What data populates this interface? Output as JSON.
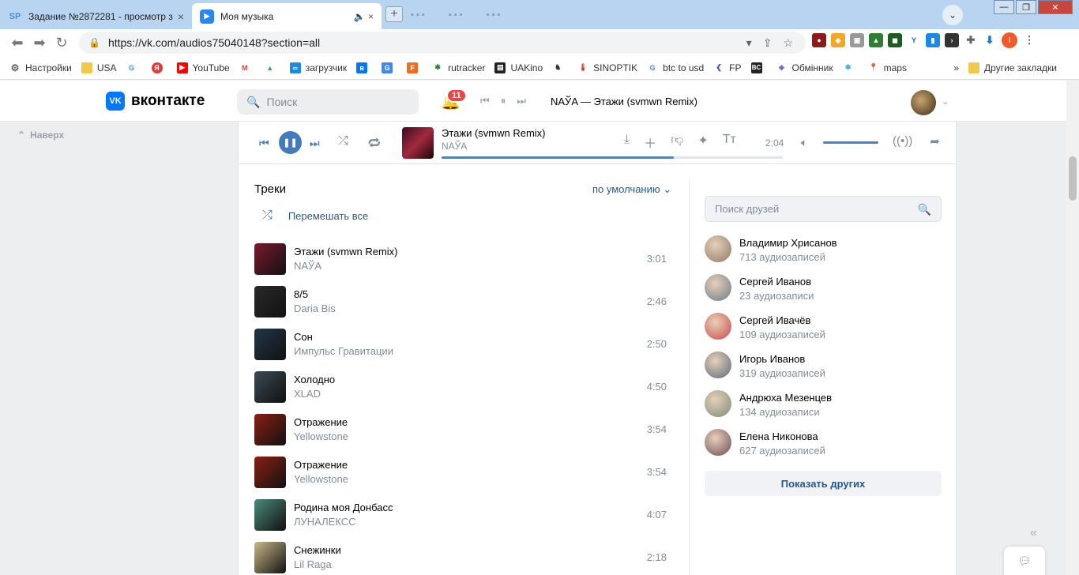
{
  "browser": {
    "tabs": [
      {
        "label": "Задание №2872281 - просмотр з",
        "icon": "SP"
      },
      {
        "label": "Моя музыка",
        "icon": "▶"
      }
    ],
    "url": "https://vk.com/audios75040148?section=all",
    "bookmarks": [
      {
        "label": "Настройки",
        "color": "#5f6368"
      },
      {
        "label": "USA",
        "color": "#f2c94c"
      },
      {
        "label": "",
        "color": "#4285f4"
      },
      {
        "label": "",
        "color": "#e53935"
      },
      {
        "label": "YouTube",
        "color": "#ff0000"
      },
      {
        "label": "",
        "color": "#d44638"
      },
      {
        "label": "",
        "color": "#34a853"
      },
      {
        "label": "загрузчик",
        "color": "#1e88e5"
      },
      {
        "label": "",
        "color": "#0077ff"
      },
      {
        "label": "",
        "color": "#4285f4"
      },
      {
        "label": "",
        "color": "#f26d21"
      },
      {
        "label": "rutracker",
        "color": "#2e7d32"
      },
      {
        "label": "UAKino",
        "color": "#222222"
      },
      {
        "label": "",
        "color": "#333333"
      },
      {
        "label": "SINOPTIK",
        "color": "#d32f2f"
      },
      {
        "label": "btc to usd",
        "color": "#4285f4"
      },
      {
        "label": "FP",
        "color": "#3f51b5"
      },
      {
        "label": "",
        "color": "#222222"
      },
      {
        "label": "Обмінник",
        "color": "#5c6bc0"
      },
      {
        "label": "",
        "color": "#29b6f6"
      },
      {
        "label": "maps",
        "color": "#34a853"
      }
    ],
    "other_bookmarks": "Другие закладки"
  },
  "header": {
    "logo_text": "вконтакте",
    "search_placeholder": "Поиск",
    "notifications_count": "11",
    "now_playing": "NAЎA — Этажи (svmwn Remix)"
  },
  "to_top": "Наверх",
  "player": {
    "title": "Этажи (svmwn Remix)",
    "artist": "NAЎA",
    "time": "2:04",
    "progress": 0.68
  },
  "tracks": {
    "title": "Треки",
    "sort_label": "по умолчанию",
    "shuffle_label": "Перемешать все",
    "items": [
      {
        "name": "Этажи (svmwn Remix)",
        "artist": "NAЎA",
        "duration": "3:01",
        "cover": "#7a1a2e"
      },
      {
        "name": "8/5",
        "artist": "Daria Bis",
        "duration": "2:46",
        "cover": "#2a2a2a"
      },
      {
        "name": "Сон",
        "artist": "Импульс Гравитации",
        "duration": "2:50",
        "cover": "#23364a"
      },
      {
        "name": "Холодно",
        "artist": "XLAD",
        "duration": "4:50",
        "cover": "#3a4a55"
      },
      {
        "name": "Отражение",
        "artist": "Yellowstone",
        "duration": "3:54",
        "cover": "#8a1f12"
      },
      {
        "name": "Отражение",
        "artist": "Yellowstone",
        "duration": "3:54",
        "cover": "#8a1f12"
      },
      {
        "name": "Родина моя Донбасс",
        "artist": "ЛУНАЛЕКСС",
        "duration": "4:07",
        "cover": "#4a8a7a"
      },
      {
        "name": "Снежинки",
        "artist": "Lil Raga",
        "duration": "2:18",
        "cover": "#c9b98a"
      }
    ]
  },
  "friends": {
    "search_placeholder": "Поиск друзей",
    "items": [
      {
        "name": "Владимир Хрисанов",
        "count": "713 аудиозаписей",
        "color": "#8a7a6a"
      },
      {
        "name": "Сергей Иванов",
        "count": "23 аудиозаписи",
        "color": "#6a7a8a"
      },
      {
        "name": "Сергей Ивачёв",
        "count": "109 аудиозаписей",
        "color": "#c94a4a"
      },
      {
        "name": "Игорь Иванов",
        "count": "319 аудиозаписей",
        "color": "#5a6a7a"
      },
      {
        "name": "Андрюха Мезенцев",
        "count": "134 аудиозаписи",
        "color": "#7a8a7a"
      },
      {
        "name": "Елена Никонова",
        "count": "627 аудиозаписей",
        "color": "#6a4a5a"
      }
    ],
    "show_more": "Показать других"
  }
}
